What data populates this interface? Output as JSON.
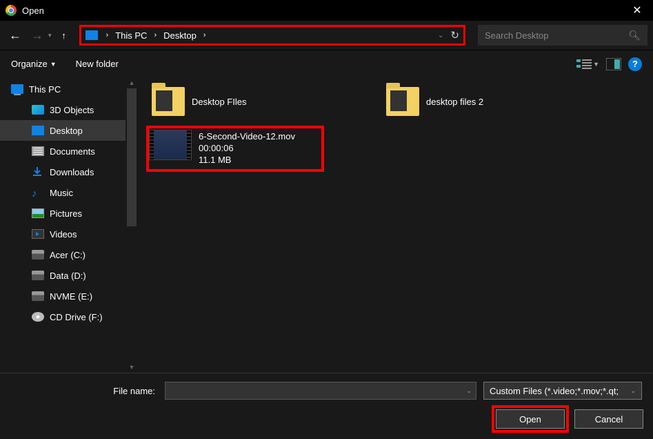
{
  "window": {
    "title": "Open"
  },
  "breadcrumb": {
    "root": "This PC",
    "current": "Desktop"
  },
  "search": {
    "placeholder": "Search Desktop"
  },
  "toolbar": {
    "organize": "Organize",
    "newfolder": "New folder"
  },
  "sidebar": {
    "root": "This PC",
    "items": [
      {
        "label": "3D Objects"
      },
      {
        "label": "Desktop"
      },
      {
        "label": "Documents"
      },
      {
        "label": "Downloads"
      },
      {
        "label": "Music"
      },
      {
        "label": "Pictures"
      },
      {
        "label": "Videos"
      },
      {
        "label": "Acer (C:)"
      },
      {
        "label": "Data (D:)"
      },
      {
        "label": "NVME (E:)"
      },
      {
        "label": "CD Drive (F:)"
      }
    ]
  },
  "files": {
    "folder1": "Desktop FIles",
    "folder2": "desktop files 2",
    "video": {
      "name": "6-Second-Video-12.mov",
      "duration": "00:00:06",
      "size": "11.1 MB"
    }
  },
  "footer": {
    "filename_label": "File name:",
    "filetype": "Custom Files (*.video;*.mov;*.qt;",
    "open": "Open",
    "cancel": "Cancel"
  },
  "help": "?"
}
